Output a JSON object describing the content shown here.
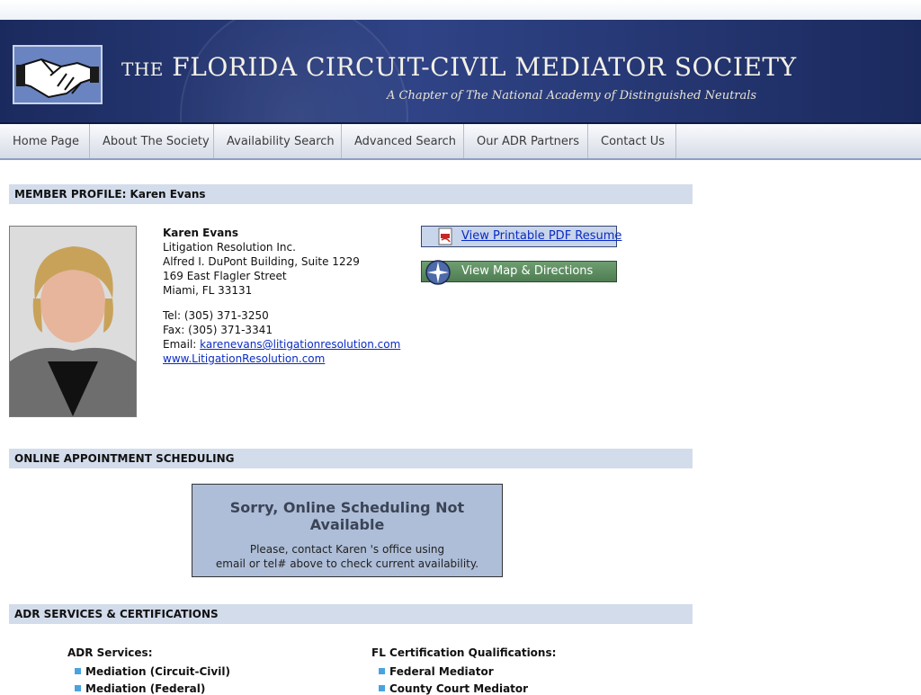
{
  "site": {
    "title_the": "THE",
    "title": "FLORIDA CIRCUIT-CIVIL MEDIATOR SOCIETY",
    "subtitle": "A Chapter of The National Academy of Distinguished Neutrals"
  },
  "nav": [
    "Home Page",
    "About The Society",
    "Availability Search",
    "Advanced Search",
    "Our ADR Partners",
    "Contact Us"
  ],
  "profile": {
    "header": "MEMBER PROFILE: Karen Evans",
    "name": "Karen Evans",
    "company": "Litigation Resolution Inc.",
    "address1": "Alfred I. DuPont Building, Suite 1229",
    "address2": "169 East Flagler Street",
    "city": "Miami, FL 33131",
    "tel": "Tel: (305) 371-3250",
    "fax": "Fax: (305) 371-3341",
    "email_label": "Email:",
    "email": "karenevans@litigationresolution.com",
    "website": "www.LitigationResolution.com",
    "pdf_button": "View Printable PDF Resume",
    "map_button": "View Map & Directions"
  },
  "scheduling": {
    "header": "ONLINE APPOINTMENT SCHEDULING",
    "title": "Sorry, Online Scheduling Not Available",
    "msg1": "Please, contact Karen 's office using",
    "msg2": "email or tel# above to check current availability."
  },
  "adr": {
    "header": "ADR SERVICES & CERTIFICATIONS",
    "services_title": "ADR Services:",
    "services": [
      "Mediation (Circuit-Civil)",
      "Mediation (Federal)"
    ],
    "certs_title": "FL Certification Qualifications:",
    "certs": [
      "Federal Mediator",
      "County Court Mediator"
    ]
  },
  "colors": {
    "banner": "#1b2a5e",
    "section_bar": "#d3dceb",
    "link": "#0a2bc4",
    "bullet": "#4aa3df"
  },
  "icons": [
    "handshake-logo-icon",
    "pdf-icon",
    "compass-icon",
    "bullet-icon"
  ]
}
